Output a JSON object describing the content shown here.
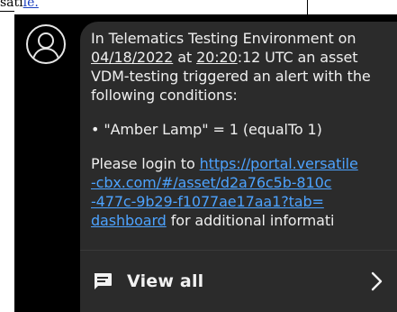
{
  "background": {
    "partial_text": "sati",
    "partial_link": "le."
  },
  "notification": {
    "avatar_icon": "person-icon",
    "message_lines": {
      "l1": "In Telematics Testing Environment on",
      "l2_date": "04/18/2022",
      "l2_mid": " at ",
      "l2_time": "20:20",
      "l2_rest": ":12 UTC an asset",
      "l3": "VDM-testing triggered an alert with the",
      "l4": "following conditions:",
      "l5": "• \"Amber Lamp\" = 1 (equalTo 1)",
      "l6_pre": "Please login to ",
      "l6_link": "https://portal.versatile",
      "l7_link": "-cbx.com/#/asset/d2a76c5b-810c",
      "l8_link": "-477c-9b29-f1077ae17aa1?tab=",
      "l9_link": "dashboard",
      "l9_rest": " for additional informati"
    },
    "view_all_label": "View all",
    "chat_icon": "chat-bubble-icon",
    "chevron_icon": "chevron-right-icon"
  }
}
